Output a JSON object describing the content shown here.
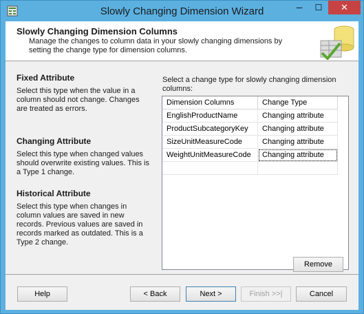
{
  "window": {
    "title": "Slowly Changing Dimension Wizard",
    "minimize_glyph": "─",
    "maximize_glyph": "☐",
    "close_glyph": "✕"
  },
  "header": {
    "title": "Slowly Changing Dimension Columns",
    "description": "Manage the changes to column data in your slowly changing dimensions by setting the change type for dimension columns."
  },
  "left_info": [
    {
      "title": "Fixed Attribute",
      "text": "Select this type when the value in a column should not change. Changes are treated as errors."
    },
    {
      "title": "Changing Attribute",
      "text": "Select this type when changed values should overwrite existing values. This is a Type 1 change."
    },
    {
      "title": "Historical Attribute",
      "text": "Select this type when changes in column values are saved in new records. Previous values are saved in records marked as outdated. This is a Type 2 change."
    }
  ],
  "prompt": "Select a change type for slowly changing dimension columns:",
  "grid": {
    "headers": [
      "Dimension Columns",
      "Change Type"
    ],
    "rows": [
      [
        "EnglishProductName",
        "Changing attribute"
      ],
      [
        "ProductSubcategoryKey",
        "Changing attribute"
      ],
      [
        "SizeUnitMeasureCode",
        "Changing attribute"
      ],
      [
        "WeightUnitMeasureCode",
        "Changing attribute"
      ]
    ]
  },
  "buttons": {
    "remove": "Remove",
    "help": "Help",
    "back": "< Back",
    "next": "Next >",
    "finish": "Finish >>|",
    "cancel": "Cancel"
  },
  "colors": {
    "titlebar": "#5bb0e0",
    "close_button": "#c74343"
  }
}
